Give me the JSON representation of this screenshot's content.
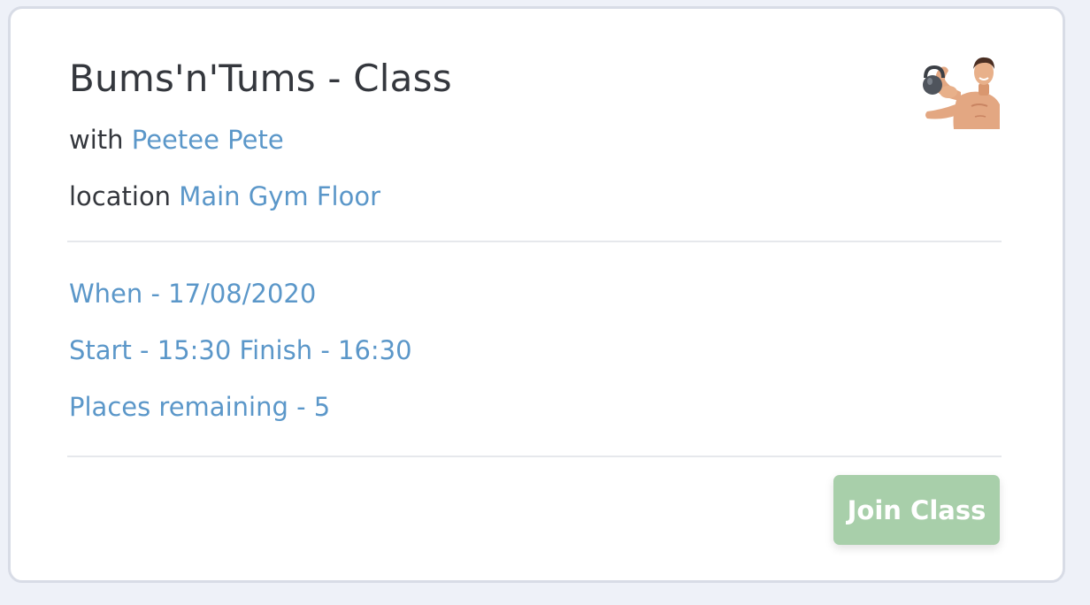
{
  "class_card": {
    "title": "Bums'n'Tums - Class",
    "instructor_prefix": "with",
    "instructor_name": "Peetee Pete",
    "location_prefix": "location",
    "location_name": "Main Gym Floor",
    "when_label": "When",
    "when_value": " - 17/08/2020",
    "start_label": "Start",
    "start_value": " - 15:30 ",
    "finish_label": "Finish",
    "finish_value": " - 16:30",
    "places_label": "Places remaining",
    "places_value": " - 5",
    "join_button_label": "Join Class",
    "avatar_icon": "trainer-kettlebell-icon"
  },
  "colors": {
    "link": "#5b97c9",
    "text": "#34373d",
    "button": "#a8cfaa",
    "background": "#eef1f8"
  }
}
